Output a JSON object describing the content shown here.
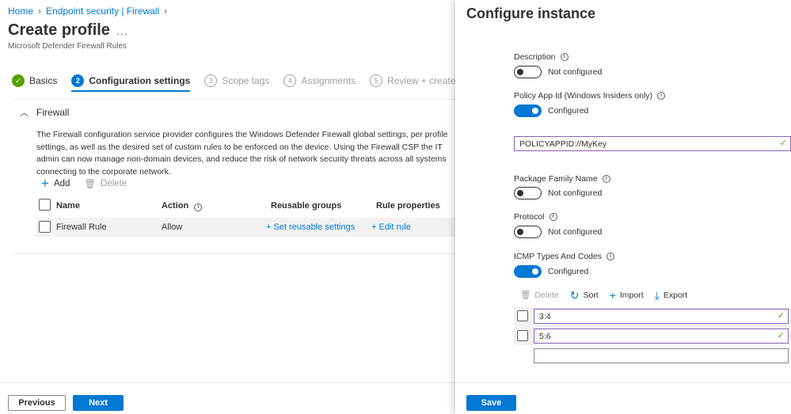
{
  "breadcrumb": {
    "items": [
      "Home",
      "Endpoint security | Firewall"
    ]
  },
  "page": {
    "title": "Create profile",
    "more": "...",
    "subtitle": "Microsoft Defender Firewall Rules"
  },
  "wizard": {
    "steps": [
      {
        "num": "✓",
        "label": "Basics",
        "state": "done"
      },
      {
        "num": "2",
        "label": "Configuration settings",
        "state": "active"
      },
      {
        "num": "3",
        "label": "Scope tags",
        "state": "pending"
      },
      {
        "num": "4",
        "label": "Assignments",
        "state": "pending"
      },
      {
        "num": "5",
        "label": "Review + create",
        "state": "pending"
      }
    ]
  },
  "section": {
    "title": "Firewall",
    "description": "The Firewall configuration service provider configures the Windows Defender Firewall global settings, per profile settings, as well as the desired set of custom rules to be enforced on the device. Using the Firewall CSP the IT admin can now manage non-domain devices, and reduce the risk of network security threats across all systems connecting to the corporate network.",
    "add_label": "Add",
    "delete_label": "Delete"
  },
  "table": {
    "columns": [
      "Name",
      "Action",
      "Reusable groups",
      "Rule properties"
    ],
    "rows": [
      {
        "name": "Firewall Rule",
        "action": "Allow",
        "reusable": "+ Set reusable settings",
        "rule": "+ Edit rule"
      }
    ]
  },
  "footer": {
    "previous": "Previous",
    "next": "Next"
  },
  "panel": {
    "title": "Configure instance",
    "description": {
      "label": "Description",
      "state": "Not configured"
    },
    "policy_app_id": {
      "label": "Policy App Id (Windows Insiders only)",
      "state": "Configured",
      "value": "POLICYAPPID://MyKey"
    },
    "package_family": {
      "label": "Package Family Name",
      "state": "Not configured"
    },
    "protocol": {
      "label": "Protocol",
      "state": "Not configured"
    },
    "icmp": {
      "label": "ICMP Types And Codes",
      "state": "Configured",
      "actions": {
        "delete": "Delete",
        "sort": "Sort",
        "import": "Import",
        "export": "Export"
      },
      "entries": [
        "3:4",
        "5:6",
        ""
      ]
    },
    "save": "Save"
  },
  "colors": {
    "accent": "#0078d4",
    "success": "#57a300",
    "valid_border": "#8764b8"
  }
}
